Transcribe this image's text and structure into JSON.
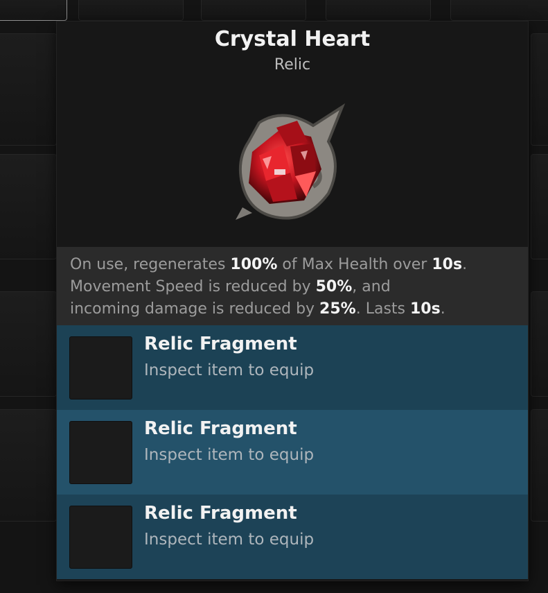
{
  "item": {
    "name": "Crystal Heart",
    "type": "Relic"
  },
  "description": {
    "line1": [
      "On use, regenerates ",
      "100%",
      " of Max Health over ",
      "10s",
      "."
    ],
    "line2": [
      "Movement Speed is reduced by ",
      "50%",
      ", and"
    ],
    "line3": [
      "incoming damage is reduced by ",
      "25%",
      ". Lasts ",
      "10s",
      "."
    ]
  },
  "slots": [
    {
      "name": "Relic Fragment",
      "hint": "Inspect item to equip"
    },
    {
      "name": "Relic Fragment",
      "hint": "Inspect item to equip"
    },
    {
      "name": "Relic Fragment",
      "hint": "Inspect item to equip"
    }
  ],
  "colors": {
    "panel": "#171717",
    "description_bg": "#2b2b2b",
    "slot_bg": "#1c4255",
    "slot_bg_highlight": "#24526a",
    "gem": "#c4141f"
  },
  "icons": {
    "item_art": "crystal-heart-relic-icon"
  }
}
